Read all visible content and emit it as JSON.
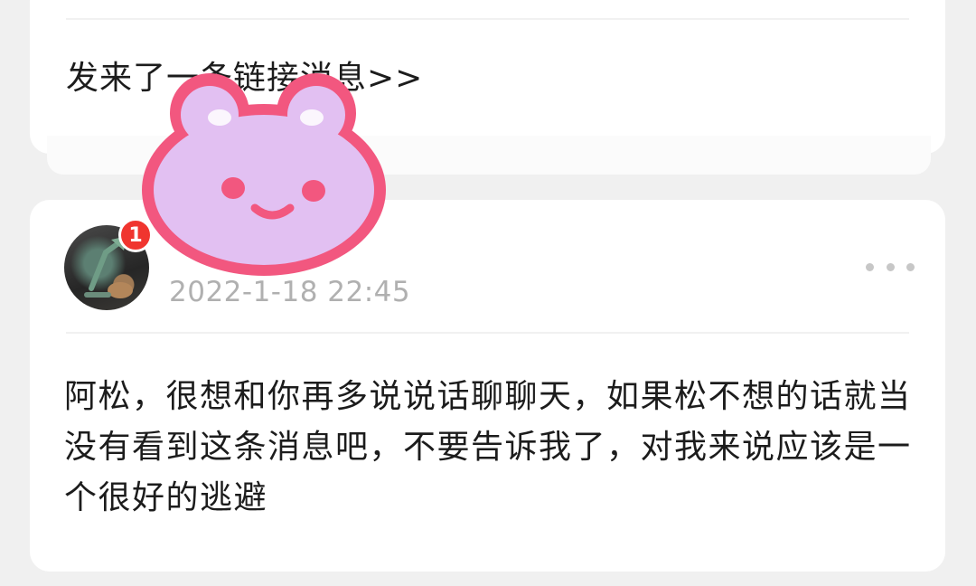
{
  "top_card": {
    "link_text": "发来了一条链接消息>>"
  },
  "post": {
    "badge_count": "1",
    "timestamp": "2022-1-18 22:45",
    "more_icon": "ellipsis-horizontal-icon",
    "message": "阿松，很想和你再多说说话聊聊天，如果松不想的话就当没有看到这条消息吧，不要告诉我了，对我来说应该是一个很好的逃避"
  },
  "sticker": {
    "icon": "pink-bear-sticker",
    "face_color": "#e2c0f2",
    "outline_color": "#f2577f"
  },
  "colors": {
    "badge": "#f0352f",
    "timestamp": "#b0b0b0",
    "text": "#1c1c1c",
    "background": "#f0f0f0"
  }
}
